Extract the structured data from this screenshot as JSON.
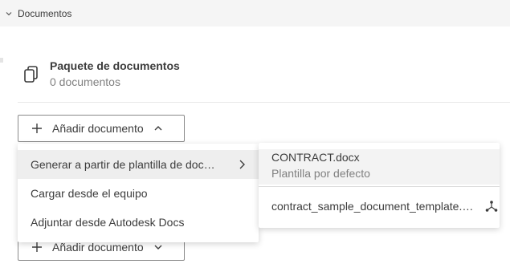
{
  "section": {
    "title": "Documentos",
    "icon": "chevron-down-icon"
  },
  "package": {
    "icon": "copy-documents-icon",
    "title": "Paquete de documentos",
    "subtitle": "0 documentos"
  },
  "add_button_top": {
    "label": "Añadir documento",
    "icon": "plus-icon",
    "caret": "chevron-up-icon"
  },
  "add_button_bottom": {
    "label": "Añadir documento",
    "icon": "plus-icon",
    "caret": "chevron-down-icon"
  },
  "menu": {
    "items": [
      {
        "label": "Generar a partir de plantilla de doc…",
        "has_submenu": true
      },
      {
        "label": "Cargar desde el equipo"
      },
      {
        "label": "Adjuntar desde Autodesk Docs"
      }
    ]
  },
  "submenu": {
    "items": [
      {
        "title": "CONTRACT.docx",
        "subtitle": "Plantilla por defecto"
      },
      {
        "title": "contract_sample_document_template.…",
        "icon": "share-network-icon"
      }
    ]
  }
}
